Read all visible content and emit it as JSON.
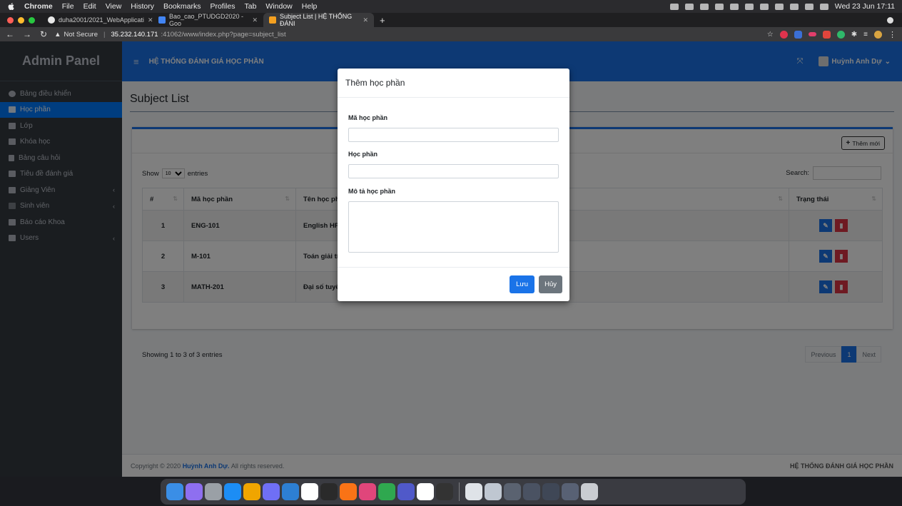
{
  "menubar": {
    "app": "Chrome",
    "items": [
      "File",
      "Edit",
      "View",
      "History",
      "Bookmarks",
      "Profiles",
      "Tab",
      "Window",
      "Help"
    ],
    "clock": "Wed 23 Jun  17:11"
  },
  "tabs": [
    {
      "title": "duha2001/2021_WebApplicati",
      "icon_color": "#e8e8e8"
    },
    {
      "title": "Bao_cao_PTUDGD2020 - Goo",
      "icon_color": "#4285f4"
    },
    {
      "title": "Subject List | HỆ THỐNG ĐÁNI",
      "icon_color": "#f4a020"
    }
  ],
  "address": {
    "security": "Not Secure",
    "host": "35.232.140.171",
    "path": ":41062/www/index.php?page=subject_list"
  },
  "sidebar": {
    "brand": "Admin Panel",
    "items": [
      {
        "label": "Bảng điều khiển",
        "icon": "dashboard-icon",
        "active": false,
        "chevron": ""
      },
      {
        "label": "Học phần",
        "icon": "list-icon",
        "active": true,
        "chevron": ""
      },
      {
        "label": "Lớp",
        "icon": "class-icon",
        "active": false,
        "chevron": ""
      },
      {
        "label": "Khóa học",
        "icon": "calendar-icon",
        "active": false,
        "chevron": ""
      },
      {
        "label": "Bảng câu hỏi",
        "icon": "file-icon",
        "active": false,
        "chevron": ""
      },
      {
        "label": "Tiêu đề đánh giá",
        "icon": "list-icon",
        "active": false,
        "chevron": ""
      },
      {
        "label": "Giảng Viên",
        "icon": "users-icon",
        "active": false,
        "chevron": "‹"
      },
      {
        "label": "Sinh viên",
        "icon": "student-icon",
        "active": false,
        "chevron": "‹"
      },
      {
        "label": "Báo cáo Khoa",
        "icon": "report-icon",
        "active": false,
        "chevron": ""
      },
      {
        "label": "Users",
        "icon": "users-icon",
        "active": false,
        "chevron": "‹"
      }
    ]
  },
  "topnav": {
    "title": "HỆ THỐNG ĐÁNH GIÁ HỌC PHẦN",
    "user": "Huỳnh Anh Dự",
    "chevron": "⌄"
  },
  "content": {
    "heading": "Subject List",
    "add_button": "Thêm mới",
    "show_label": "Show",
    "entries_value": "10",
    "entries_label": "entries",
    "search_label": "Search:",
    "columns": [
      "#",
      "Mã học phần",
      "Tên học phần",
      "Trạng thái"
    ],
    "rows": [
      {
        "no": "1",
        "code": "ENG-101",
        "name": "English HP 1"
      },
      {
        "no": "2",
        "code": "M-101",
        "name": "Toán giải tích"
      },
      {
        "no": "3",
        "code": "MATH-201",
        "name": "Đại số tuyến"
      }
    ],
    "info": "Showing 1 to 3 of 3 entries",
    "pager": {
      "prev": "Previous",
      "current": "1",
      "next": "Next"
    }
  },
  "footer": {
    "prefix": "Copyright © 2020",
    "owner": "Huỳnh Anh Dự.",
    "suffix": "All rights reserved.",
    "right": "HỆ THỐNG ĐÁNH GIÁ HỌC PHẦN"
  },
  "modal": {
    "title": "Thêm học phần",
    "code_label": "Mã học phần",
    "code_value": "",
    "name_label": "Học phần",
    "name_value": "",
    "desc_label": "Mô tả học phần",
    "desc_value": "",
    "save": "Lưu",
    "cancel": "Hủy"
  },
  "colors": {
    "accent": "#1a73e8",
    "danger": "#dc3545",
    "sidebar": "#343a40"
  },
  "dock": [
    {
      "name": "finder-icon",
      "color": "#3a8ee6"
    },
    {
      "name": "launchpad-icon",
      "color": "#8e6ff0"
    },
    {
      "name": "safari-icon",
      "color": "#9aa0a6"
    },
    {
      "name": "maps-icon",
      "color": "#1c8df5"
    },
    {
      "name": "chrome-icon",
      "color": "#f0a500"
    },
    {
      "name": "messenger-icon",
      "color": "#6f6ff5"
    },
    {
      "name": "vscode-icon",
      "color": "#2d7fd3"
    },
    {
      "name": "notion-icon",
      "color": "#ffffff"
    },
    {
      "name": "terminal-app-icon",
      "color": "#2a2a2a"
    },
    {
      "name": "sublime-icon",
      "color": "#f97316"
    },
    {
      "name": "screen-icon",
      "color": "#e0467b"
    },
    {
      "name": "vim-icon",
      "color": "#2fa84f"
    },
    {
      "name": "teams-icon",
      "color": "#5059c9"
    },
    {
      "name": "slack-icon",
      "color": "#ffffff"
    },
    {
      "name": "terminal-icon",
      "color": "#333333"
    }
  ],
  "dock_recent": [
    {
      "name": "document-icon",
      "color": "#dfe3e8"
    },
    {
      "name": "preview-icon",
      "color": "#bfc7d1"
    },
    {
      "name": "window-thumb-icon",
      "color": "#5a6270"
    },
    {
      "name": "window-thumb-icon",
      "color": "#4a5262"
    },
    {
      "name": "window-thumb-icon",
      "color": "#3f4756"
    },
    {
      "name": "window-thumb-icon",
      "color": "#586174"
    },
    {
      "name": "trash-icon",
      "color": "#c9ccd1"
    }
  ]
}
